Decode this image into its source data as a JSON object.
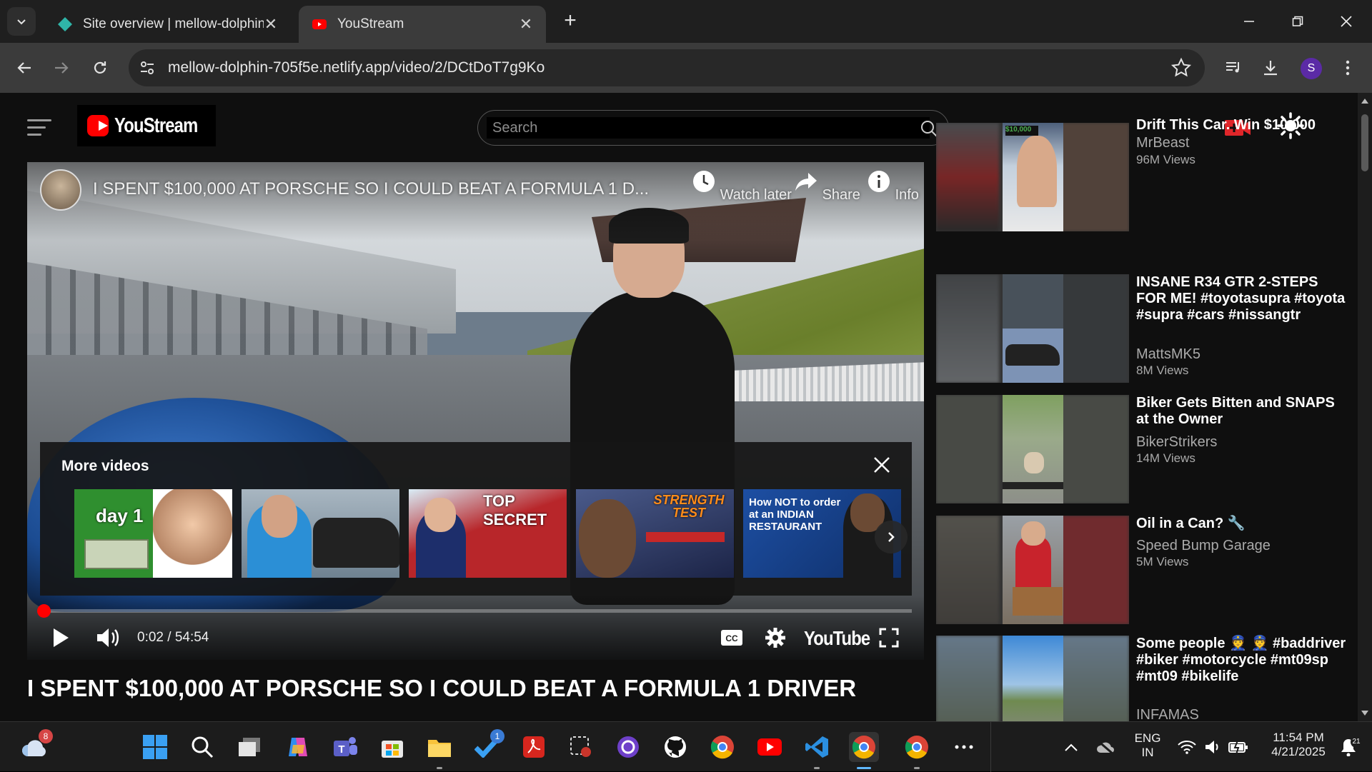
{
  "browser": {
    "tabs": [
      {
        "title": "Site overview | mellow-dolphin",
        "active": false
      },
      {
        "title": "YouStream",
        "active": true
      }
    ],
    "url": "mellow-dolphin-705f5e.netlify.app/video/2/DCtDoT7g9Ko",
    "profile_initial": "S"
  },
  "header": {
    "logo_text": "YouStream",
    "search_placeholder": "Search"
  },
  "player": {
    "title": "I SPENT $100,000 AT PORSCHE SO I COULD BEAT A FORMULA 1 D...",
    "actions": {
      "watch_later": "Watch later",
      "share": "Share",
      "info": "Info"
    },
    "more_videos": {
      "heading": "More videos",
      "thumbs": [
        {
          "caption": "day 1",
          "bg": "#2f8f2f"
        },
        {
          "caption": "",
          "bg": "#8fa0ad"
        },
        {
          "caption": "TOP SECRET",
          "bg": "#b8262a"
        },
        {
          "caption": "STRENGTH TEST",
          "bg": "#2b3a6b"
        },
        {
          "caption": "How NOT to order at an INDIAN RESTAURANT",
          "bg": "#1d4fa3"
        }
      ]
    },
    "time": "0:02 / 54:54",
    "progress_fraction": 0.0006,
    "brand": "YouTube"
  },
  "video_title": "I SPENT $100,000 AT PORSCHE SO I COULD BEAT A FORMULA 1 DRIVER",
  "recommendations": [
    {
      "title": "Drift This Car, Win $10,000",
      "channel": "MrBeast",
      "views": "96M Views"
    },
    {
      "title": "INSANE R34 GTR 2-STEPS FOR ME! #toyotasupra #toyota #supra #cars #nissangtr",
      "channel": "MattsMK5",
      "views": "8M Views"
    },
    {
      "title": "Biker Gets Bitten and SNAPS at the Owner",
      "channel": "BikerStrikers",
      "views": "14M Views"
    },
    {
      "title": "Oil in a Can? 🔧",
      "channel": "Speed Bump Garage",
      "views": "5M Views"
    },
    {
      "title": "Some people 👮 👮 #baddriver #biker #motorcycle #mt09sp #mt09 #bikelife",
      "channel": "INFAMAS",
      "views": ""
    }
  ],
  "taskbar": {
    "weather_badge": "8",
    "todo_badge": "1",
    "lang_top": "ENG",
    "lang_bottom": "IN",
    "time": "11:54 PM",
    "date": "4/21/2025",
    "notif_badge": "21"
  }
}
